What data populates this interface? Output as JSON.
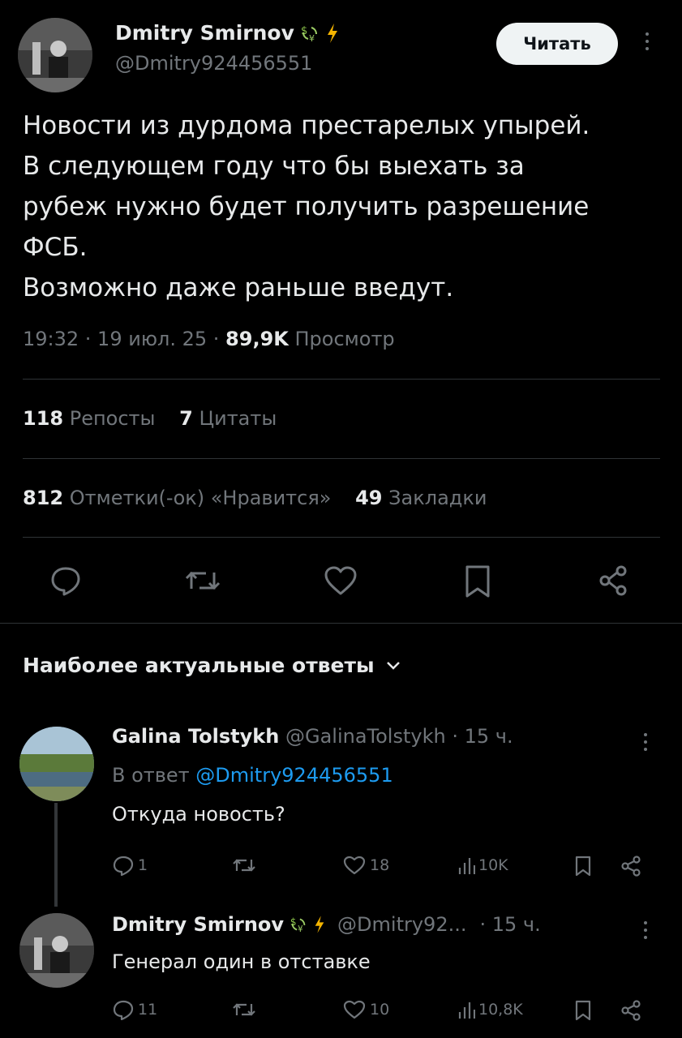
{
  "post": {
    "author_name": "Dmitry Smirnov",
    "author_handle": "@Dmitry924456551",
    "read_label": "Читать",
    "text_lines": [
      "Новости из дурдома престарелых упырей.",
      "В следующем году что бы выехать за",
      "рубеж нужно будет получить разрешение",
      "ФСБ.",
      "Возможно даже раньше введут."
    ],
    "time": "19:32 · 19 июл. 25 · ",
    "views_value": "89,9K",
    "views_label": " Просмотр",
    "reposts_value": "118",
    "reposts_label": " Репосты",
    "quotes_value": "7",
    "quotes_label": " Цитаты",
    "likes_value": "812",
    "likes_label": " Отметки(-ок) «Нравится»",
    "bookmarks_value": "49",
    "bookmarks_label": " Закладки"
  },
  "replies_header": "Наиболее актуальные ответы",
  "replies": [
    {
      "name": "Galina Tolstykh",
      "handle": "@GalinaTolstykh",
      "time": " · 15 ч.",
      "reply_to_prefix": "В ответ ",
      "reply_to_handle": "@Dmitry924456551",
      "text": "Откуда новость?",
      "replies_count": "1",
      "likes_count": "18",
      "views_count": "10K"
    },
    {
      "name": "Dmitry Smirnov",
      "handle": "@Dmitry92...",
      "time": " · 15 ч.",
      "text": "Генерал один в отставке",
      "replies_count": "11",
      "likes_count": "10",
      "views_count": "10,8K"
    }
  ],
  "icons": {
    "reply": "speech-bubble-icon",
    "repost": "repost-arrows-icon",
    "like": "heart-icon",
    "bookmark": "bookmark-icon",
    "share": "share-nodes-icon",
    "views": "bar-chart-icon",
    "badge_money": "money-exchange-icon",
    "badge_lightning": "lightning-icon",
    "chevron": "chevron-down-icon"
  },
  "colors": {
    "background": "#000000",
    "text": "#e7e9ea",
    "muted": "#71767b",
    "link": "#1d9bf0",
    "lightning": "#f4b400"
  }
}
